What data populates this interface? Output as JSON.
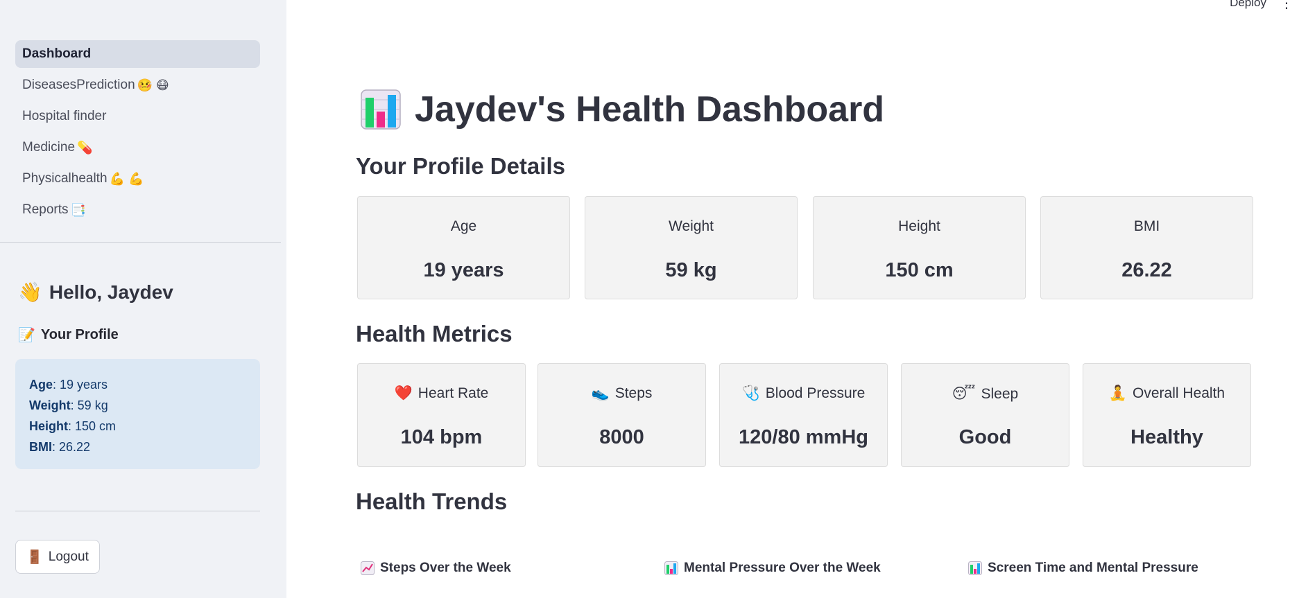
{
  "sidebar": {
    "nav": [
      {
        "label": "Dashboard",
        "emoji": "",
        "active": true
      },
      {
        "label": "DiseasesPrediction",
        "emoji": "🤒 😷",
        "active": false
      },
      {
        "label": "Hospital finder",
        "emoji": "",
        "active": false
      },
      {
        "label": "Medicine",
        "emoji": "💊",
        "active": false
      },
      {
        "label": "Physicalhealth",
        "emoji": "💪 💪",
        "active": false
      },
      {
        "label": "Reports",
        "emoji": "📑",
        "active": false
      }
    ],
    "greeting": "Hello, Jaydev",
    "greeting_emoji": "👋",
    "profile_heading": "Your Profile",
    "profile_emoji": "📝",
    "profile": {
      "age_label": "Age",
      "age_value": ": 19 years",
      "weight_label": "Weight",
      "weight_value": ": 59 kg",
      "height_label": "Height",
      "height_value": ": 150 cm",
      "bmi_label": "BMI",
      "bmi_value": ": 26.22"
    },
    "logout_label": "Logout",
    "logout_emoji": "🚪"
  },
  "topbar": {
    "deploy_label": "Deploy",
    "menu_glyph": "⋮"
  },
  "main": {
    "title": "Jaydev's Health Dashboard",
    "profile_section": "Your Profile Details",
    "profile_cards": [
      {
        "label": "Age",
        "value": "19 years"
      },
      {
        "label": "Weight",
        "value": "59 kg"
      },
      {
        "label": "Height",
        "value": "150 cm"
      },
      {
        "label": "BMI",
        "value": "26.22"
      }
    ],
    "metrics_section": "Health Metrics",
    "metric_cards": [
      {
        "emoji": "❤️",
        "label": "Heart Rate",
        "value": "104 bpm"
      },
      {
        "emoji": "👟",
        "label": "Steps",
        "value": "8000"
      },
      {
        "emoji": "🩺",
        "label": "Blood Pressure",
        "value": "120/80 mmHg"
      },
      {
        "emoji": "😴",
        "label": "Sleep",
        "value": "Good"
      },
      {
        "emoji": "🧘",
        "label": "Overall Health",
        "value": "Healthy"
      }
    ],
    "trends_section": "Health Trends",
    "trends": [
      {
        "label": "Steps Over the Week",
        "icon": "line-chart-icon"
      },
      {
        "label": "Mental Pressure Over the Week",
        "icon": "bar-chart-icon"
      },
      {
        "label": "Screen Time and Mental Pressure",
        "icon": "bar-chart-icon"
      }
    ]
  },
  "colors": {
    "sidebar_bg": "#f0f2f6",
    "nav_active_bg": "#d8dde7",
    "profile_box_bg": "#dce8f4",
    "profile_box_text": "#143a6b",
    "card_bg": "#f3f3f3",
    "text": "#31333f"
  }
}
